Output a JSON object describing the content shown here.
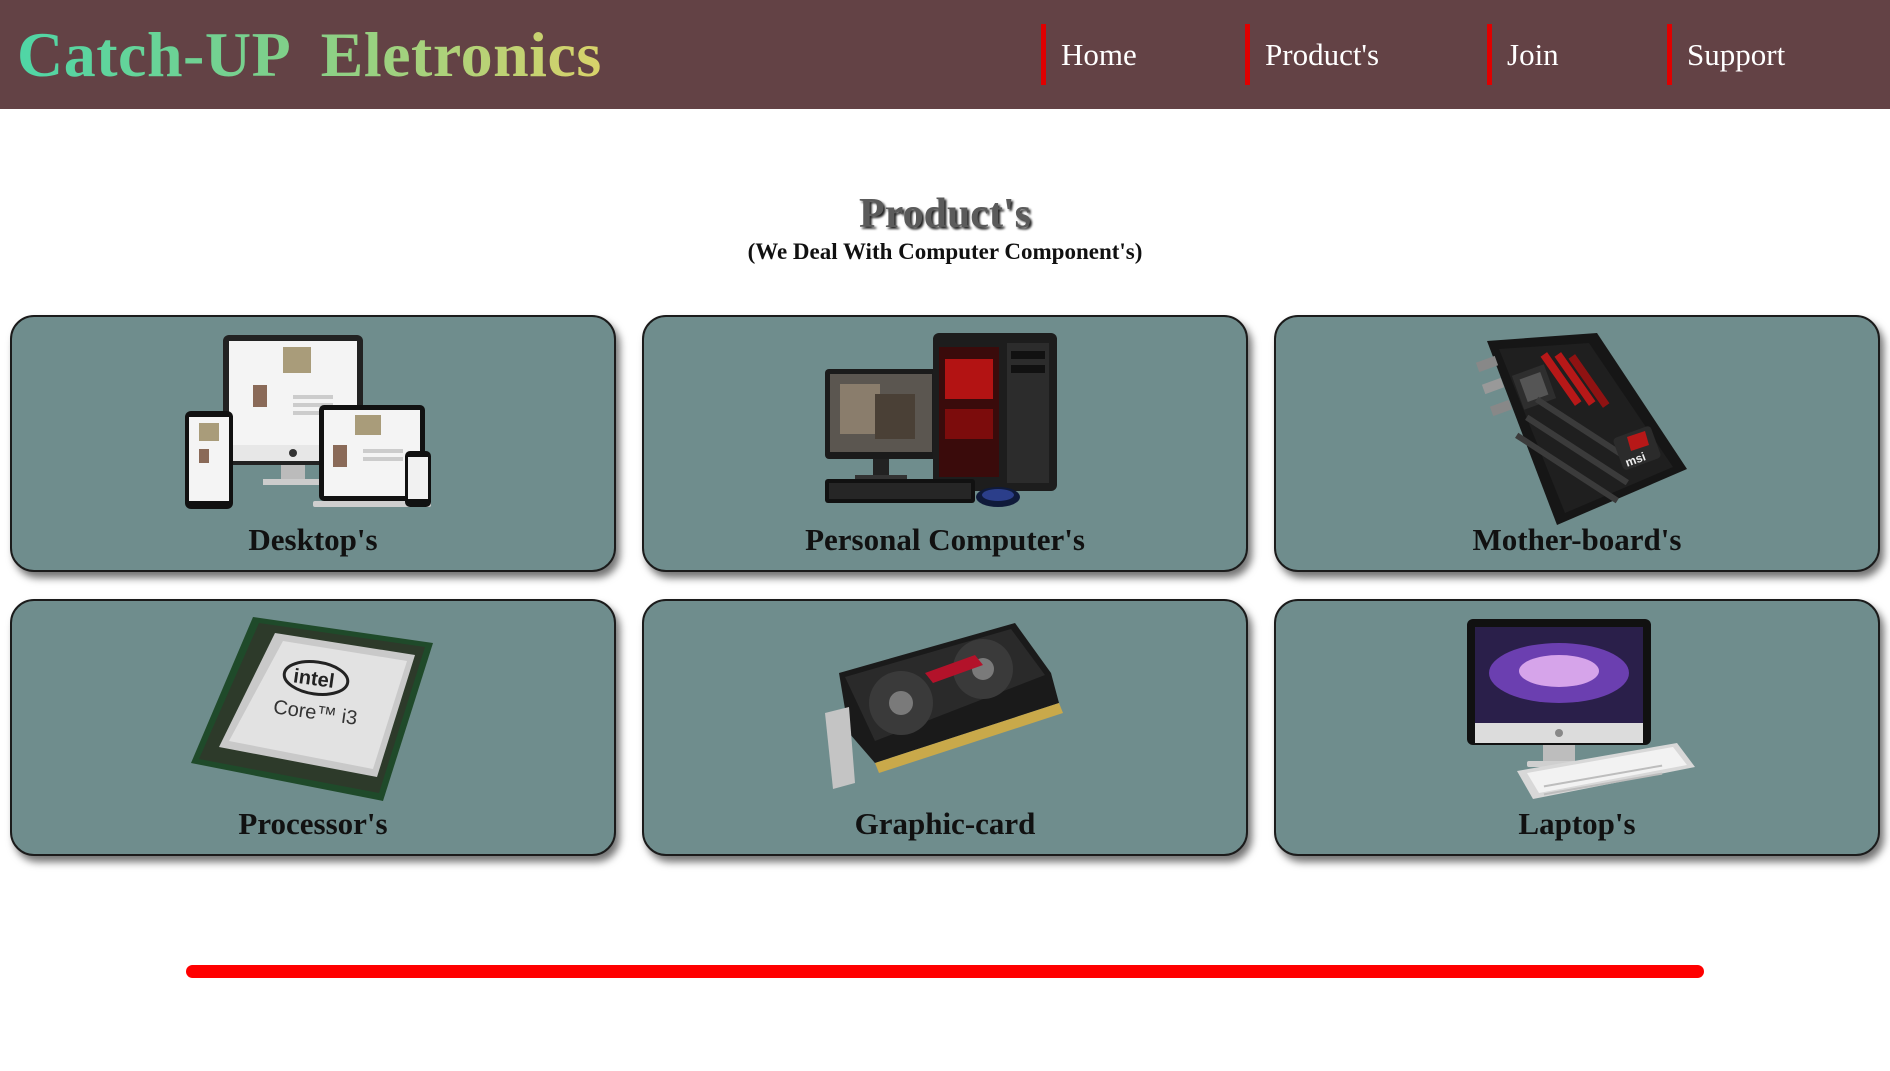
{
  "header": {
    "brand": "Catch-UP  Eletronics",
    "nav": [
      {
        "label": "Home"
      },
      {
        "label": "Product's"
      },
      {
        "label": "Join"
      },
      {
        "label": "Support"
      }
    ]
  },
  "main": {
    "title": "Product's",
    "subtitle": "(We Deal With Computer Component's)",
    "cards": [
      {
        "label": "Desktop's",
        "image": "responsive-devices-image"
      },
      {
        "label": "Personal Computer's",
        "image": "gaming-pc-image"
      },
      {
        "label": "Mother-board's",
        "image": "motherboard-image"
      },
      {
        "label": "Processor's",
        "image": "intel-core-i3-chip-image"
      },
      {
        "label": "Graphic-card",
        "image": "graphics-card-image"
      },
      {
        "label": "Laptop's",
        "image": "imac-keyboard-image"
      }
    ],
    "chip_text": {
      "brand": "intel",
      "model": "Core™ i3"
    },
    "mobo_text": "msi"
  },
  "colors": {
    "header_bg": "#634245",
    "nav_accent": "#e00000",
    "card_bg": "#6f8d8d",
    "divider": "#ff0000"
  }
}
